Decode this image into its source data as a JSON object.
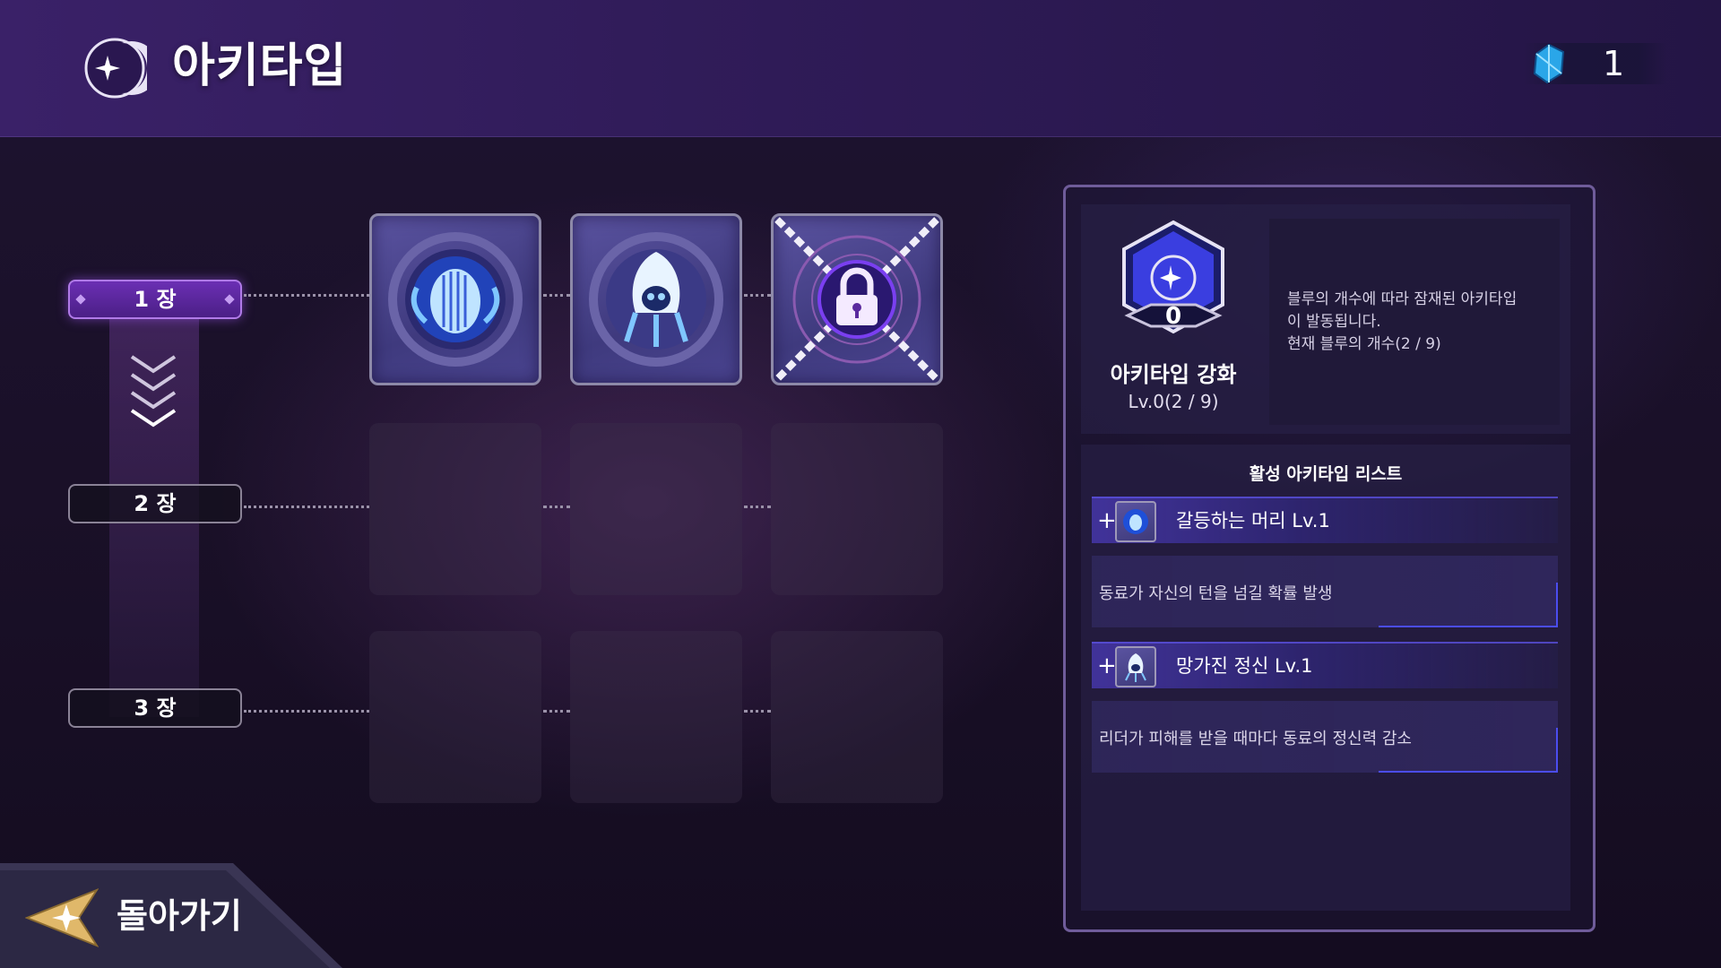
{
  "header": {
    "title": "아키타입",
    "logo_icon": "crescent-moon-star-icon",
    "currency_icon": "blue-crystal-icon",
    "currency_value": "1"
  },
  "chapters": [
    {
      "label": "1 장",
      "active": true
    },
    {
      "label": "2 장",
      "active": false
    },
    {
      "label": "3 장",
      "active": false
    }
  ],
  "cards": [
    {
      "name": "writhing-head-icon",
      "state": "unlocked"
    },
    {
      "name": "broken-spirit-icon",
      "state": "unlocked"
    },
    {
      "name": "chained-lock-icon",
      "state": "locked"
    }
  ],
  "enhance": {
    "emblem_value": "0",
    "title": "아키타입 강화",
    "level": "Lv.0(2 / 9)",
    "desc_line1": "블루의 개수에 따라 잠재된 아키타입",
    "desc_line2": "이 발동됩니다.",
    "desc_line3": "현재 블루의 개수(2 / 9)"
  },
  "active_list": {
    "title": "활성 아키타입 리스트",
    "items": [
      {
        "plus": "+",
        "name": "갈등하는 머리 Lv.1",
        "desc": "동료가 자신의 턴을 넘길 확률 발생"
      },
      {
        "plus": "+",
        "name": "망가진 정신 Lv.1",
        "desc": "리더가 피해를 받을 때마다 동료의 정신력 감소"
      }
    ]
  },
  "back": {
    "label": "돌아가기"
  },
  "colors": {
    "accent_purple": "#6b2fb4",
    "panel_border": "#6f5c9a",
    "highlight_blue": "#4b4df0",
    "card_bg": "#4a4490"
  }
}
